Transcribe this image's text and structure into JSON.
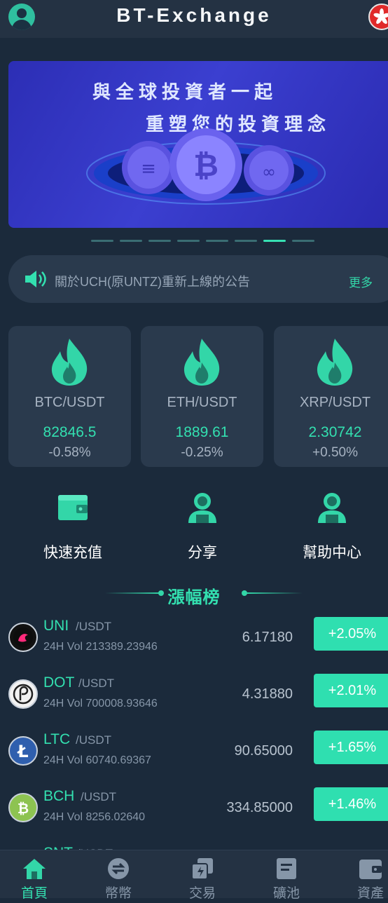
{
  "header": {
    "title": "BT-Exchange",
    "avatar_icon": "user-avatar-icon",
    "language_icon": "hong-kong-flag-icon"
  },
  "banner": {
    "line1": "與全球投資者一起",
    "line2": "重塑您的投資理念",
    "slide_count": 8,
    "active_slide": 7
  },
  "notice": {
    "icon": "speaker-icon",
    "text": "關於UCH(原UNTZ)重新上線的公告",
    "more_label": "更多"
  },
  "tickers": [
    {
      "pair": "BTC/USDT",
      "price": "82846.5",
      "change": "-0.58%"
    },
    {
      "pair": "ETH/USDT",
      "price": "1889.61",
      "change": "-0.25%"
    },
    {
      "pair": "XRP/USDT",
      "price": "2.30742",
      "change": "+0.50%"
    }
  ],
  "quick_menu": [
    {
      "label": "快速充值",
      "icon": "wallet-icon"
    },
    {
      "label": "分享",
      "icon": "users-icon"
    },
    {
      "label": "幫助中心",
      "icon": "support-icon"
    }
  ],
  "gainers": {
    "title": "漲幅榜",
    "rows": [
      {
        "symbol": "UNI",
        "quote": "/USDT",
        "vol_label": "24H Vol",
        "vol": "213389.23946",
        "price": "6.17180",
        "change": "+2.05%",
        "icon": "uni-coin-icon"
      },
      {
        "symbol": "DOT",
        "quote": "/USDT",
        "vol_label": "24H Vol",
        "vol": "700008.93646",
        "price": "4.31880",
        "change": "+2.01%",
        "icon": "dot-coin-icon"
      },
      {
        "symbol": "LTC",
        "quote": "/USDT",
        "vol_label": "24H Vol",
        "vol": "60740.69367",
        "price": "90.65000",
        "change": "+1.65%",
        "icon": "ltc-coin-icon"
      },
      {
        "symbol": "BCH",
        "quote": "/USDT",
        "vol_label": "24H Vol",
        "vol": "8256.02640",
        "price": "334.85000",
        "change": "+1.46%",
        "icon": "bch-coin-icon"
      },
      {
        "symbol": "SNT",
        "quote": "/USDT",
        "vol_label": "",
        "vol": "",
        "price": "",
        "change": "",
        "icon": "snt-coin-icon"
      }
    ]
  },
  "tabbar": [
    {
      "label": "首頁",
      "icon": "home-icon",
      "active": true
    },
    {
      "label": "幣幣",
      "icon": "exchange-icon",
      "active": false
    },
    {
      "label": "交易",
      "icon": "trade-icon",
      "active": false
    },
    {
      "label": "礦池",
      "icon": "pool-icon",
      "active": false
    },
    {
      "label": "資產",
      "icon": "assets-wallet-icon",
      "active": false
    }
  ],
  "colors": {
    "background": "#1b2a3b",
    "panel": "#2a3a4d",
    "accent": "#33e0b0",
    "header": "#243243"
  }
}
